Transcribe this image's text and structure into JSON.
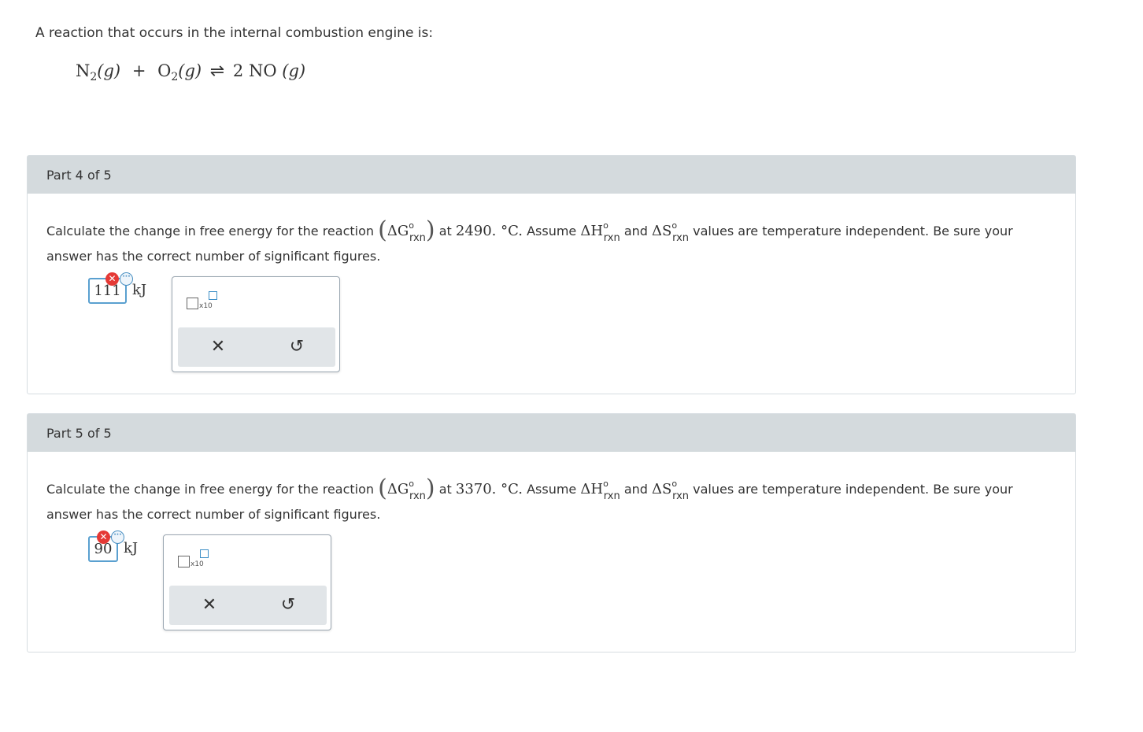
{
  "intro": {
    "text": "A reaction that occurs in the internal combustion engine is:"
  },
  "equation": {
    "r1": "N",
    "r1_sub": "2",
    "r1_state": "(g)",
    "plus": "+",
    "r2": "O",
    "r2_sub": "2",
    "r2_state": "(g)",
    "arrow": "⇌",
    "product": "2 NO",
    "product_state": "(g)"
  },
  "parts": [
    {
      "header": "Part 4 of 5",
      "q_prefix": "Calculate the change in free energy for the reaction",
      "dG": "ΔG",
      "deg": "o",
      "rxn": "rxn",
      "q_at": "at",
      "temperature": "2490. °C.",
      "q_assume": "Assume",
      "dH": "ΔH",
      "q_and": "and",
      "dS": "ΔS",
      "q_suffix": "values are temperature independent. Be sure your",
      "q_line2": "answer has the correct number of significant figures.",
      "answer_value": "111",
      "unit": "kJ",
      "status": "incorrect",
      "err_glyph": "✕",
      "more_glyph": "···",
      "x10_label": "x10",
      "clear_glyph": "✕",
      "undo_glyph": "↺"
    },
    {
      "header": "Part 5 of 5",
      "q_prefix": "Calculate the change in free energy for the reaction",
      "dG": "ΔG",
      "deg": "o",
      "rxn": "rxn",
      "q_at": "at",
      "temperature": "3370. °C.",
      "q_assume": "Assume",
      "dH": "ΔH",
      "q_and": "and",
      "dS": "ΔS",
      "q_suffix": "values are temperature independent. Be sure your",
      "q_line2": "answer has the correct number of significant figures.",
      "answer_value": "90",
      "unit": "kJ",
      "status": "incorrect",
      "err_glyph": "✕",
      "more_glyph": "···",
      "x10_label": "x10",
      "clear_glyph": "✕",
      "undo_glyph": "↺"
    }
  ],
  "colors": {
    "header_bg": "#d4dadd",
    "input_border": "#5aa0d0",
    "error_red": "#e53935",
    "accent_blue": "#4a90c2"
  }
}
